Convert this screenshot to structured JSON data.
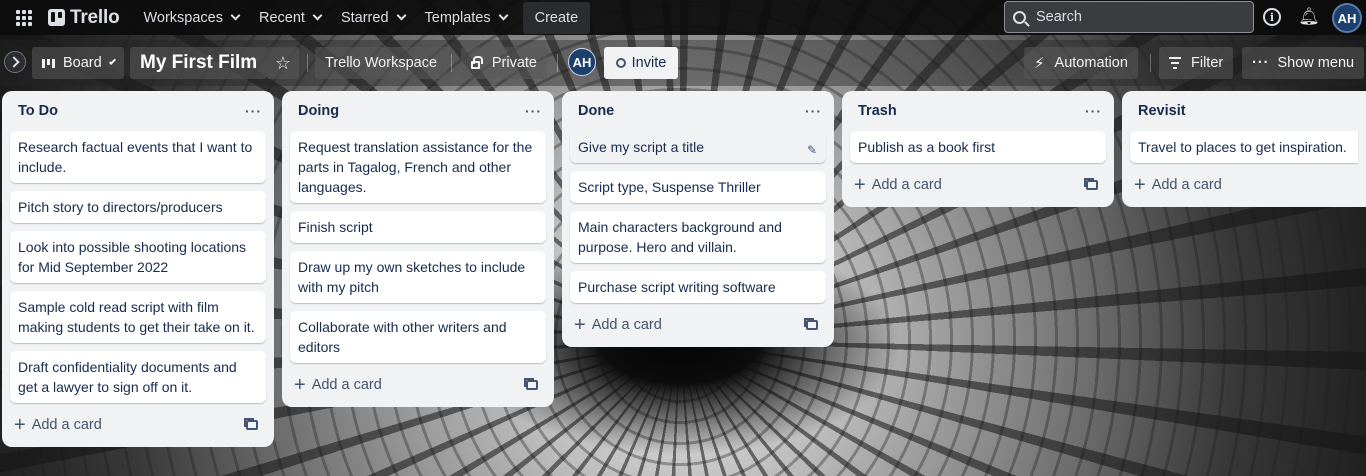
{
  "nav": {
    "logo": "Trello",
    "workspaces": "Workspaces",
    "recent": "Recent",
    "starred": "Starred",
    "templates": "Templates",
    "create": "Create",
    "search_placeholder": "Search",
    "avatar_initials": "AH"
  },
  "board": {
    "view_label": "Board",
    "title": "My First Film",
    "workspace_label": "Trello Workspace",
    "visibility_label": "Private",
    "member_initials": "AH",
    "invite_label": "Invite",
    "automation_label": "Automation",
    "filter_label": "Filter",
    "show_menu_label": "Show menu"
  },
  "lists": [
    {
      "title": "To Do",
      "cards": [
        "Research factual events that I want to include.",
        "Pitch story to directors/producers",
        "Look into possible shooting locations for Mid September 2022",
        "Sample cold read script with film making students to get their take on it.",
        "Draft confidentiality documents and get a lawyer to sign off on it."
      ],
      "add_label": "Add a card"
    },
    {
      "title": "Doing",
      "cards": [
        "Request translation assistance for the parts in Tagalog, French and other languages.",
        "Finish script",
        "Draw up my own sketches to include with my pitch",
        "Collaborate with other writers and editors"
      ],
      "add_label": "Add a card"
    },
    {
      "title": "Done",
      "cards": [
        "Give my script a title",
        "Script type, Suspense Thriller",
        "Main characters background and purpose. Hero and villain.",
        "Purchase script writing software"
      ],
      "add_label": "Add a card"
    },
    {
      "title": "Trash",
      "cards": [
        "Publish as a book first"
      ],
      "add_label": "Add a card"
    },
    {
      "title": "Revisit",
      "cards": [
        "Travel to places to get inspiration."
      ],
      "add_label": "Add a card"
    }
  ]
}
